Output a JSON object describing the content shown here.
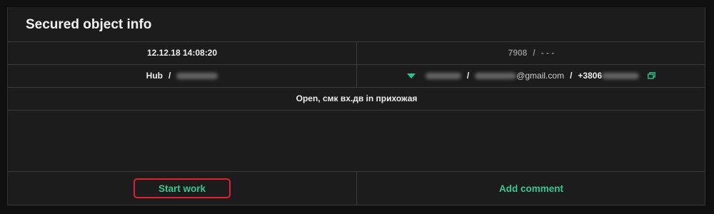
{
  "header": {
    "title": "Secured object info"
  },
  "row1": {
    "datetime": "12.12.18 14:08:20",
    "code": "7908",
    "separator": "/",
    "code_extra": "- - -"
  },
  "row2": {
    "hub_label": "Hub",
    "separator": "/",
    "email_domain": "@gmail.com",
    "phone_prefix": "+3806"
  },
  "event": {
    "text": "Open, смк вх.дв in прихожая"
  },
  "actions": {
    "start_label": "Start work",
    "comment_label": "Add comment"
  },
  "colors": {
    "accent": "#36c78e",
    "highlight": "#e0213a",
    "panel": "#1c1c1c"
  },
  "icons": {
    "dropdown": "triangle-down-icon",
    "copy": "copy-icon"
  }
}
